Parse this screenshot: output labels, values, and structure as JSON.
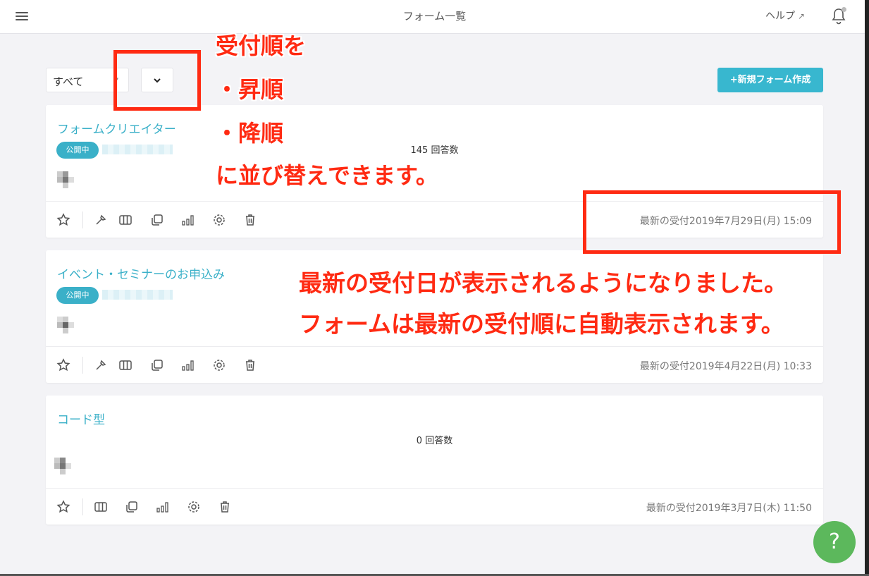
{
  "header": {
    "title": "フォーム一覧",
    "help_label": "ヘルプ",
    "external_icon": "external-link-icon",
    "bell_icon": "bell-icon",
    "menu_icon": "hamburger-menu-icon"
  },
  "toolbar": {
    "filter_value": "すべて",
    "sort_icon": "chevron-down-icon",
    "new_form_label": "+新規フォーム作成"
  },
  "forms": [
    {
      "title": "フォームクリエイター",
      "status": "公開中",
      "answers": "145 回答数",
      "received": "最新の受付2019年7月29日(月) 15:09"
    },
    {
      "title": "イベント・セミナーのお申込み",
      "status": "公開中",
      "answers": "",
      "received": "最新の受付2019年4月22日(月) 10:33"
    },
    {
      "title": "コード型",
      "status": "",
      "answers": "0 回答数",
      "received": "最新の受付2019年3月7日(木) 11:50"
    }
  ],
  "annotations": {
    "sort_line1": "受付順を",
    "sort_line2": "・昇順",
    "sort_line3": "・降順",
    "sort_line4": "に並び替えできます。",
    "latest_line1": "最新の受付日が表示されるようになりました。",
    "latest_line2": "フォームは最新の受付順に自動表示されます。"
  },
  "help_fab_label": "?",
  "colors": {
    "accent": "#38b7cf",
    "link": "#3ab0c8",
    "annotation": "#ff2a12",
    "help_fab": "#5cb85c"
  }
}
